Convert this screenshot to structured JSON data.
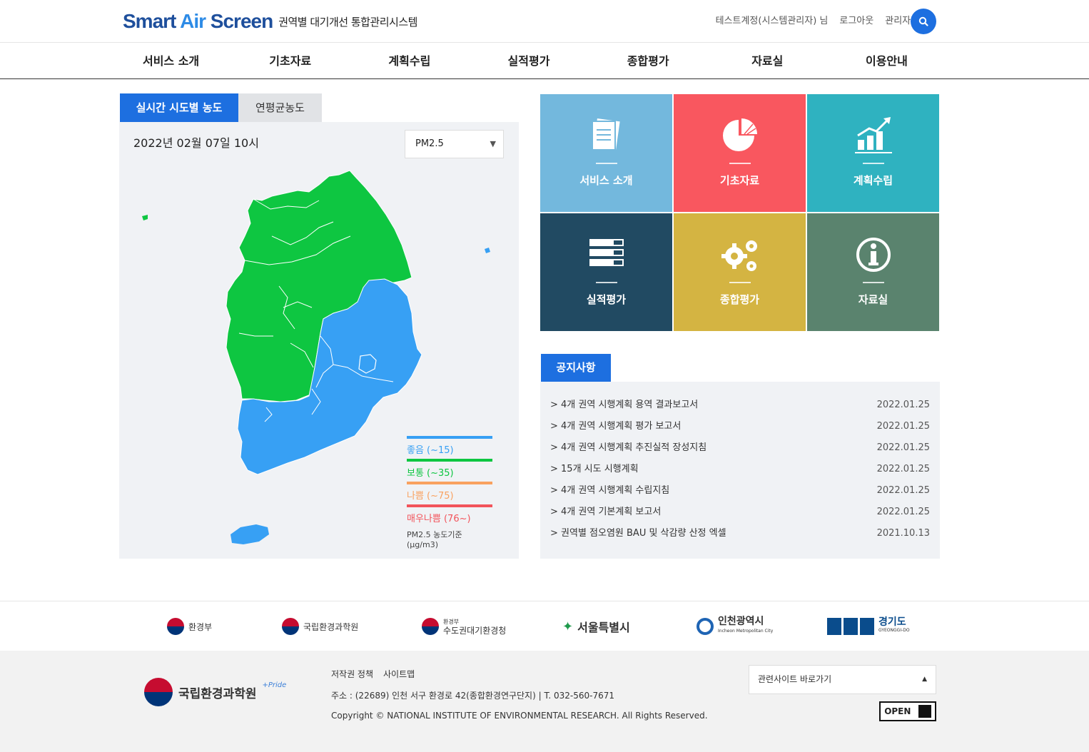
{
  "header": {
    "logo_main_1": "Smart ",
    "logo_accent": "Air",
    "logo_main_2": " Screen",
    "logo_sub": "권역별 대기개선 통합관리시스템",
    "user": "테스트계정(시스템관리자) 님",
    "logout": "로그아웃",
    "admin": "관리자페이지",
    "search_icon": "search-icon"
  },
  "gnb": [
    "서비스 소개",
    "기초자료",
    "계획수립",
    "실적평가",
    "종합평가",
    "자료실",
    "이용안내"
  ],
  "map": {
    "tabs": [
      "실시간 시도별 농도",
      "연평균농도"
    ],
    "date": "2022년 02월 07일 10시",
    "pollutant": "PM2.5",
    "legend": [
      {
        "label": "좋음 (~15)",
        "color": "#37a0f4"
      },
      {
        "label": "보통 (~35)",
        "color": "#0ec641"
      },
      {
        "label": "나쁨 (~75)",
        "color": "#f9a15f"
      },
      {
        "label": "매우나쁨 (76~)",
        "color": "#f2545b"
      }
    ],
    "legend_note": "PM2.5 농도기준 (μg/m3)",
    "colors": {
      "good": "#37a0f4",
      "normal": "#0ec641"
    }
  },
  "tiles": [
    {
      "label": "서비스 소개",
      "color": "#73b8dd",
      "icon": "document-icon"
    },
    {
      "label": "기초자료",
      "color": "#f9575f",
      "icon": "pie-chart-icon"
    },
    {
      "label": "계획수립",
      "color": "#2fb2c0",
      "icon": "growth-chart-icon"
    },
    {
      "label": "실적평가",
      "color": "#214a62",
      "icon": "list-icon"
    },
    {
      "label": "종합평가",
      "color": "#d4b442",
      "icon": "gears-icon"
    },
    {
      "label": "자료실",
      "color": "#5a836e",
      "icon": "info-icon"
    }
  ],
  "notice": {
    "title": "공지사항",
    "items": [
      {
        "title": "> 4개 권역 시행계획 용역 결과보고서",
        "date": "2022.01.25"
      },
      {
        "title": "> 4개 권역 시행계획 평가 보고서",
        "date": "2022.01.25"
      },
      {
        "title": "> 4개 권역 시행계획 추진실적 장성지침",
        "date": "2022.01.25"
      },
      {
        "title": "> 15개 시도 시행계획",
        "date": "2022.01.25"
      },
      {
        "title": "> 4개 권역 시행계획 수립지침",
        "date": "2022.01.25"
      },
      {
        "title": "> 4개 권역 기본계획 보고서",
        "date": "2022.01.25"
      },
      {
        "title": "> 권역별 점오염원 BAU 및 삭감량 산정 엑셀",
        "date": "2021.10.13"
      }
    ]
  },
  "partners": {
    "moe": "환경부",
    "nier": "국립환경과학원",
    "mae_small": "환경부",
    "mae": "수도권대기환경청",
    "seoul": "서울특별시",
    "incheon": "인천광역시",
    "incheon_en": "Incheon Metropolitan City",
    "gyeonggi": "경기도",
    "gyeonggi_en": "GYEONGGI-DO"
  },
  "footer": {
    "org": "국립환경과학원",
    "pride": "+Pride",
    "links": [
      "저작권 정책",
      "사이트맵"
    ],
    "address": "주소 : (22689) 인천 서구 환경로 42(종합환경연구단지) | T. 032-560-7671",
    "copyright": "Copyright © NATIONAL INSTITUTE OF ENVIRONMENTAL RESEARCH. All Rights Reserved.",
    "related": "관련사이트 바로가기",
    "open_badge": "OPEN"
  }
}
